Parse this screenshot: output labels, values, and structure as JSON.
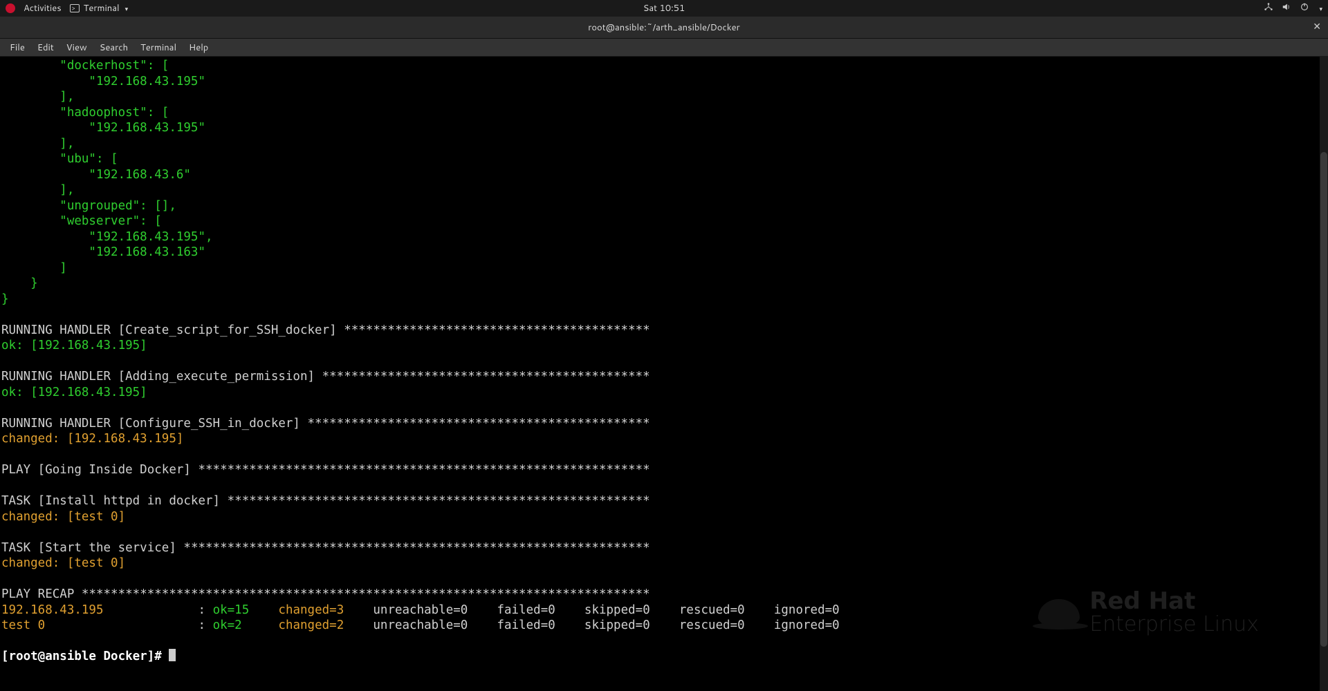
{
  "topbar": {
    "activities": "Activities",
    "app_name": "Terminal",
    "clock": "Sat 10:51"
  },
  "window": {
    "title": "root@ansible:~/arth_ansible/Docker"
  },
  "menu": {
    "file": "File",
    "edit": "Edit",
    "view": "View",
    "search": "Search",
    "terminal": "Terminal",
    "help": "Help"
  },
  "inventory_json": {
    "l1": "        \"dockerhost\": [",
    "l2": "            \"192.168.43.195\"",
    "l3": "        ],",
    "l4": "        \"hadoophost\": [",
    "l5": "            \"192.168.43.195\"",
    "l6": "        ],",
    "l7": "        \"ubu\": [",
    "l8": "            \"192.168.43.6\"",
    "l9": "        ],",
    "l10": "        \"ungrouped\": [],",
    "l11": "        \"webserver\": [",
    "l12": "            \"192.168.43.195\",",
    "l13": "            \"192.168.43.163\"",
    "l14": "        ]",
    "l15": "    }",
    "l16": "}"
  },
  "handlers": {
    "h1_title": "RUNNING HANDLER [Create_script_for_SSH_docker] ",
    "h1_fill": "******************************************",
    "h1_res": "ok: [192.168.43.195]",
    "h2_title": "RUNNING HANDLER [Adding_execute_permission] ",
    "h2_fill": "*********************************************",
    "h2_res": "ok: [192.168.43.195]",
    "h3_title": "RUNNING HANDLER [Configure_SSH_in_docker] ",
    "h3_fill": "***********************************************",
    "h3_res": "changed: [192.168.43.195]"
  },
  "play2": {
    "title": "PLAY [Going Inside Docker] ",
    "fill": "**************************************************************"
  },
  "tasks": {
    "t1_title": "TASK [Install httpd in docker] ",
    "t1_fill": "**********************************************************",
    "t1_res": "changed: [test 0]",
    "t2_title": "TASK [Start the service] ",
    "t2_fill": "****************************************************************",
    "t2_res": "changed: [test 0]"
  },
  "recap": {
    "title": "PLAY RECAP ",
    "fill": "******************************************************************************",
    "row1_host": "192.168.43.195",
    "row1_pad": "             ",
    "row1_colon": ": ",
    "row1_ok": "ok=15",
    "row1_sp1": "    ",
    "row1_ch": "changed=3",
    "row1_rest": "    unreachable=0    failed=0    skipped=0    rescued=0    ignored=0",
    "row2_host": "test 0",
    "row2_pad": "                     ",
    "row2_colon": ": ",
    "row2_ok": "ok=2",
    "row2_sp1": "     ",
    "row2_ch": "changed=2",
    "row2_rest": "    unreachable=0    failed=0    skipped=0    rescued=0    ignored=0"
  },
  "prompt": {
    "text": "[root@ansible Docker]# "
  },
  "logo": {
    "line1": "Red Hat",
    "line2": "Enterprise Linux"
  }
}
